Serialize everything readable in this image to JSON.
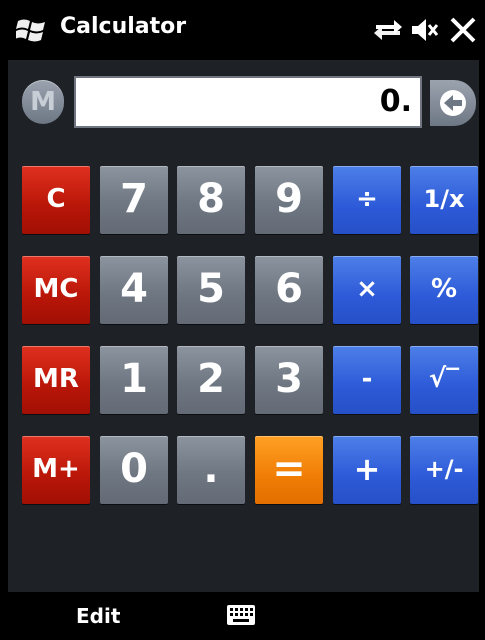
{
  "titlebar": {
    "title": "Calculator"
  },
  "display": {
    "memory_indicator": "M",
    "value": "0."
  },
  "keys": {
    "c": "C",
    "seven": "7",
    "eight": "8",
    "nine": "9",
    "divide": "÷",
    "reciprocal": "1/x",
    "mc": "MC",
    "four": "4",
    "five": "5",
    "six": "6",
    "multiply": "×",
    "percent": "%",
    "mr": "MR",
    "one": "1",
    "two": "2",
    "three": "3",
    "minus": "-",
    "sqrt": "√‾",
    "mplus": "M+",
    "zero": "0",
    "dot": ".",
    "equals": "=",
    "plus": "+",
    "negate": "+/-"
  },
  "bottombar": {
    "left_softkey": "Edit"
  },
  "colors": {
    "memory_key": "#c21a0b",
    "digit_key": "#737b86",
    "operator_key": "#2f5bd8",
    "equals_key": "#f5820a"
  }
}
